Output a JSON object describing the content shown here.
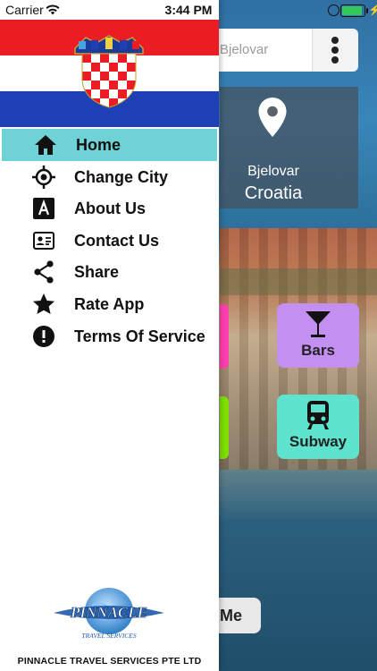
{
  "status_bar": {
    "carrier": "Carrier",
    "time": "3:44 PM"
  },
  "background_app": {
    "search_text": "Bjelovar",
    "location": {
      "city": "Bjelovar",
      "country": "Croatia"
    },
    "tiles": [
      {
        "label": "Bars",
        "icon": "cocktail-glass-icon",
        "color": "#c38ff0"
      },
      {
        "label": "Subway",
        "icon": "train-icon",
        "color": "#5fe3cf"
      }
    ],
    "contact_button_text": "Me"
  },
  "drawer": {
    "header": {
      "flag": "croatia-flag",
      "colors": [
        "#ec1c24",
        "#ffffff",
        "#1f3fb5"
      ]
    },
    "menu": [
      {
        "label": "Home",
        "icon": "home-icon",
        "active": true
      },
      {
        "label": "Change City",
        "icon": "target-icon"
      },
      {
        "label": "About Us",
        "icon": "letter-a-icon"
      },
      {
        "label": "Contact Us",
        "icon": "contact-card-icon"
      },
      {
        "label": "Share",
        "icon": "share-icon"
      },
      {
        "label": "Rate App",
        "icon": "star-icon"
      },
      {
        "label": "Terms Of Service",
        "icon": "alert-circle-icon"
      }
    ],
    "active_color": "#6fd2d6",
    "logo_text": "PINNACLE",
    "logo_subtext": "TRAVEL SERVICES",
    "footer": "PINNACLE TRAVEL SERVICES PTE LTD"
  }
}
